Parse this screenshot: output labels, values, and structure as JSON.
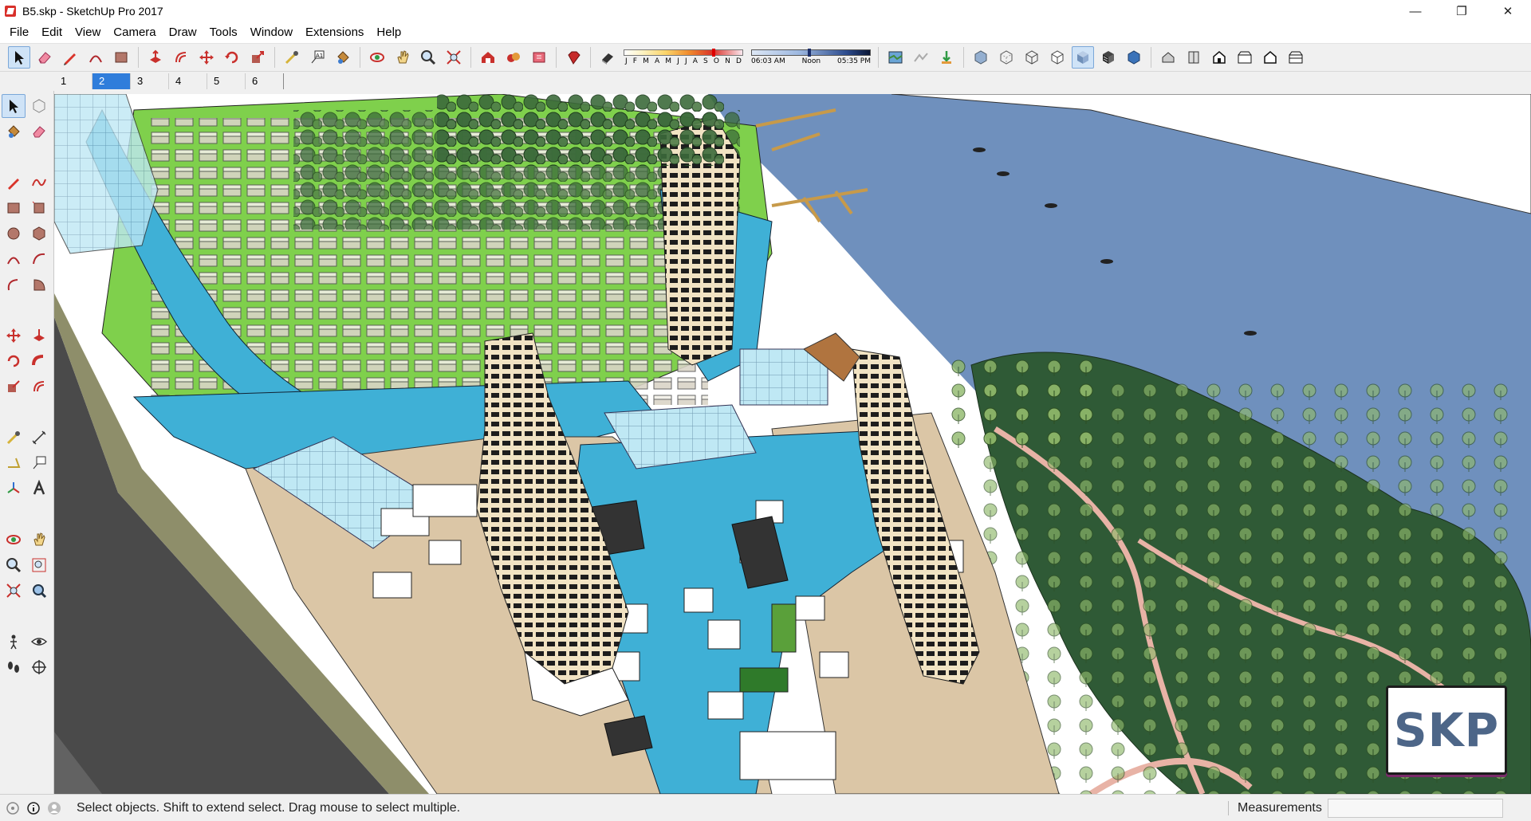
{
  "window": {
    "title": "B5.skp - SketchUp Pro 2017",
    "minimize_glyph": "—",
    "restore_glyph": "❐",
    "close_glyph": "✕"
  },
  "menu": [
    "File",
    "Edit",
    "View",
    "Camera",
    "Draw",
    "Tools",
    "Window",
    "Extensions",
    "Help"
  ],
  "shadow_settings": {
    "months": [
      "J",
      "F",
      "M",
      "A",
      "M",
      "J",
      "J",
      "A",
      "S",
      "O",
      "N",
      "D"
    ],
    "time_start": "06:03 AM",
    "time_mid": "Noon",
    "time_end": "05:35 PM"
  },
  "scenes": {
    "tabs": [
      "1",
      "2",
      "3",
      "4",
      "5",
      "6"
    ],
    "active_index": 1
  },
  "status": {
    "message": "Select objects. Shift to extend select. Drag mouse to select multiple.",
    "measurements_label": "Measurements",
    "measurements_value": ""
  },
  "watermark": "SKP",
  "colors": {
    "water": "#3fb0d6",
    "river": "#6f90bd",
    "lawn": "#7fd04c",
    "pavement": "#dbc6a6",
    "road": "#4a4a4a",
    "accent": "#2f7ddb"
  }
}
